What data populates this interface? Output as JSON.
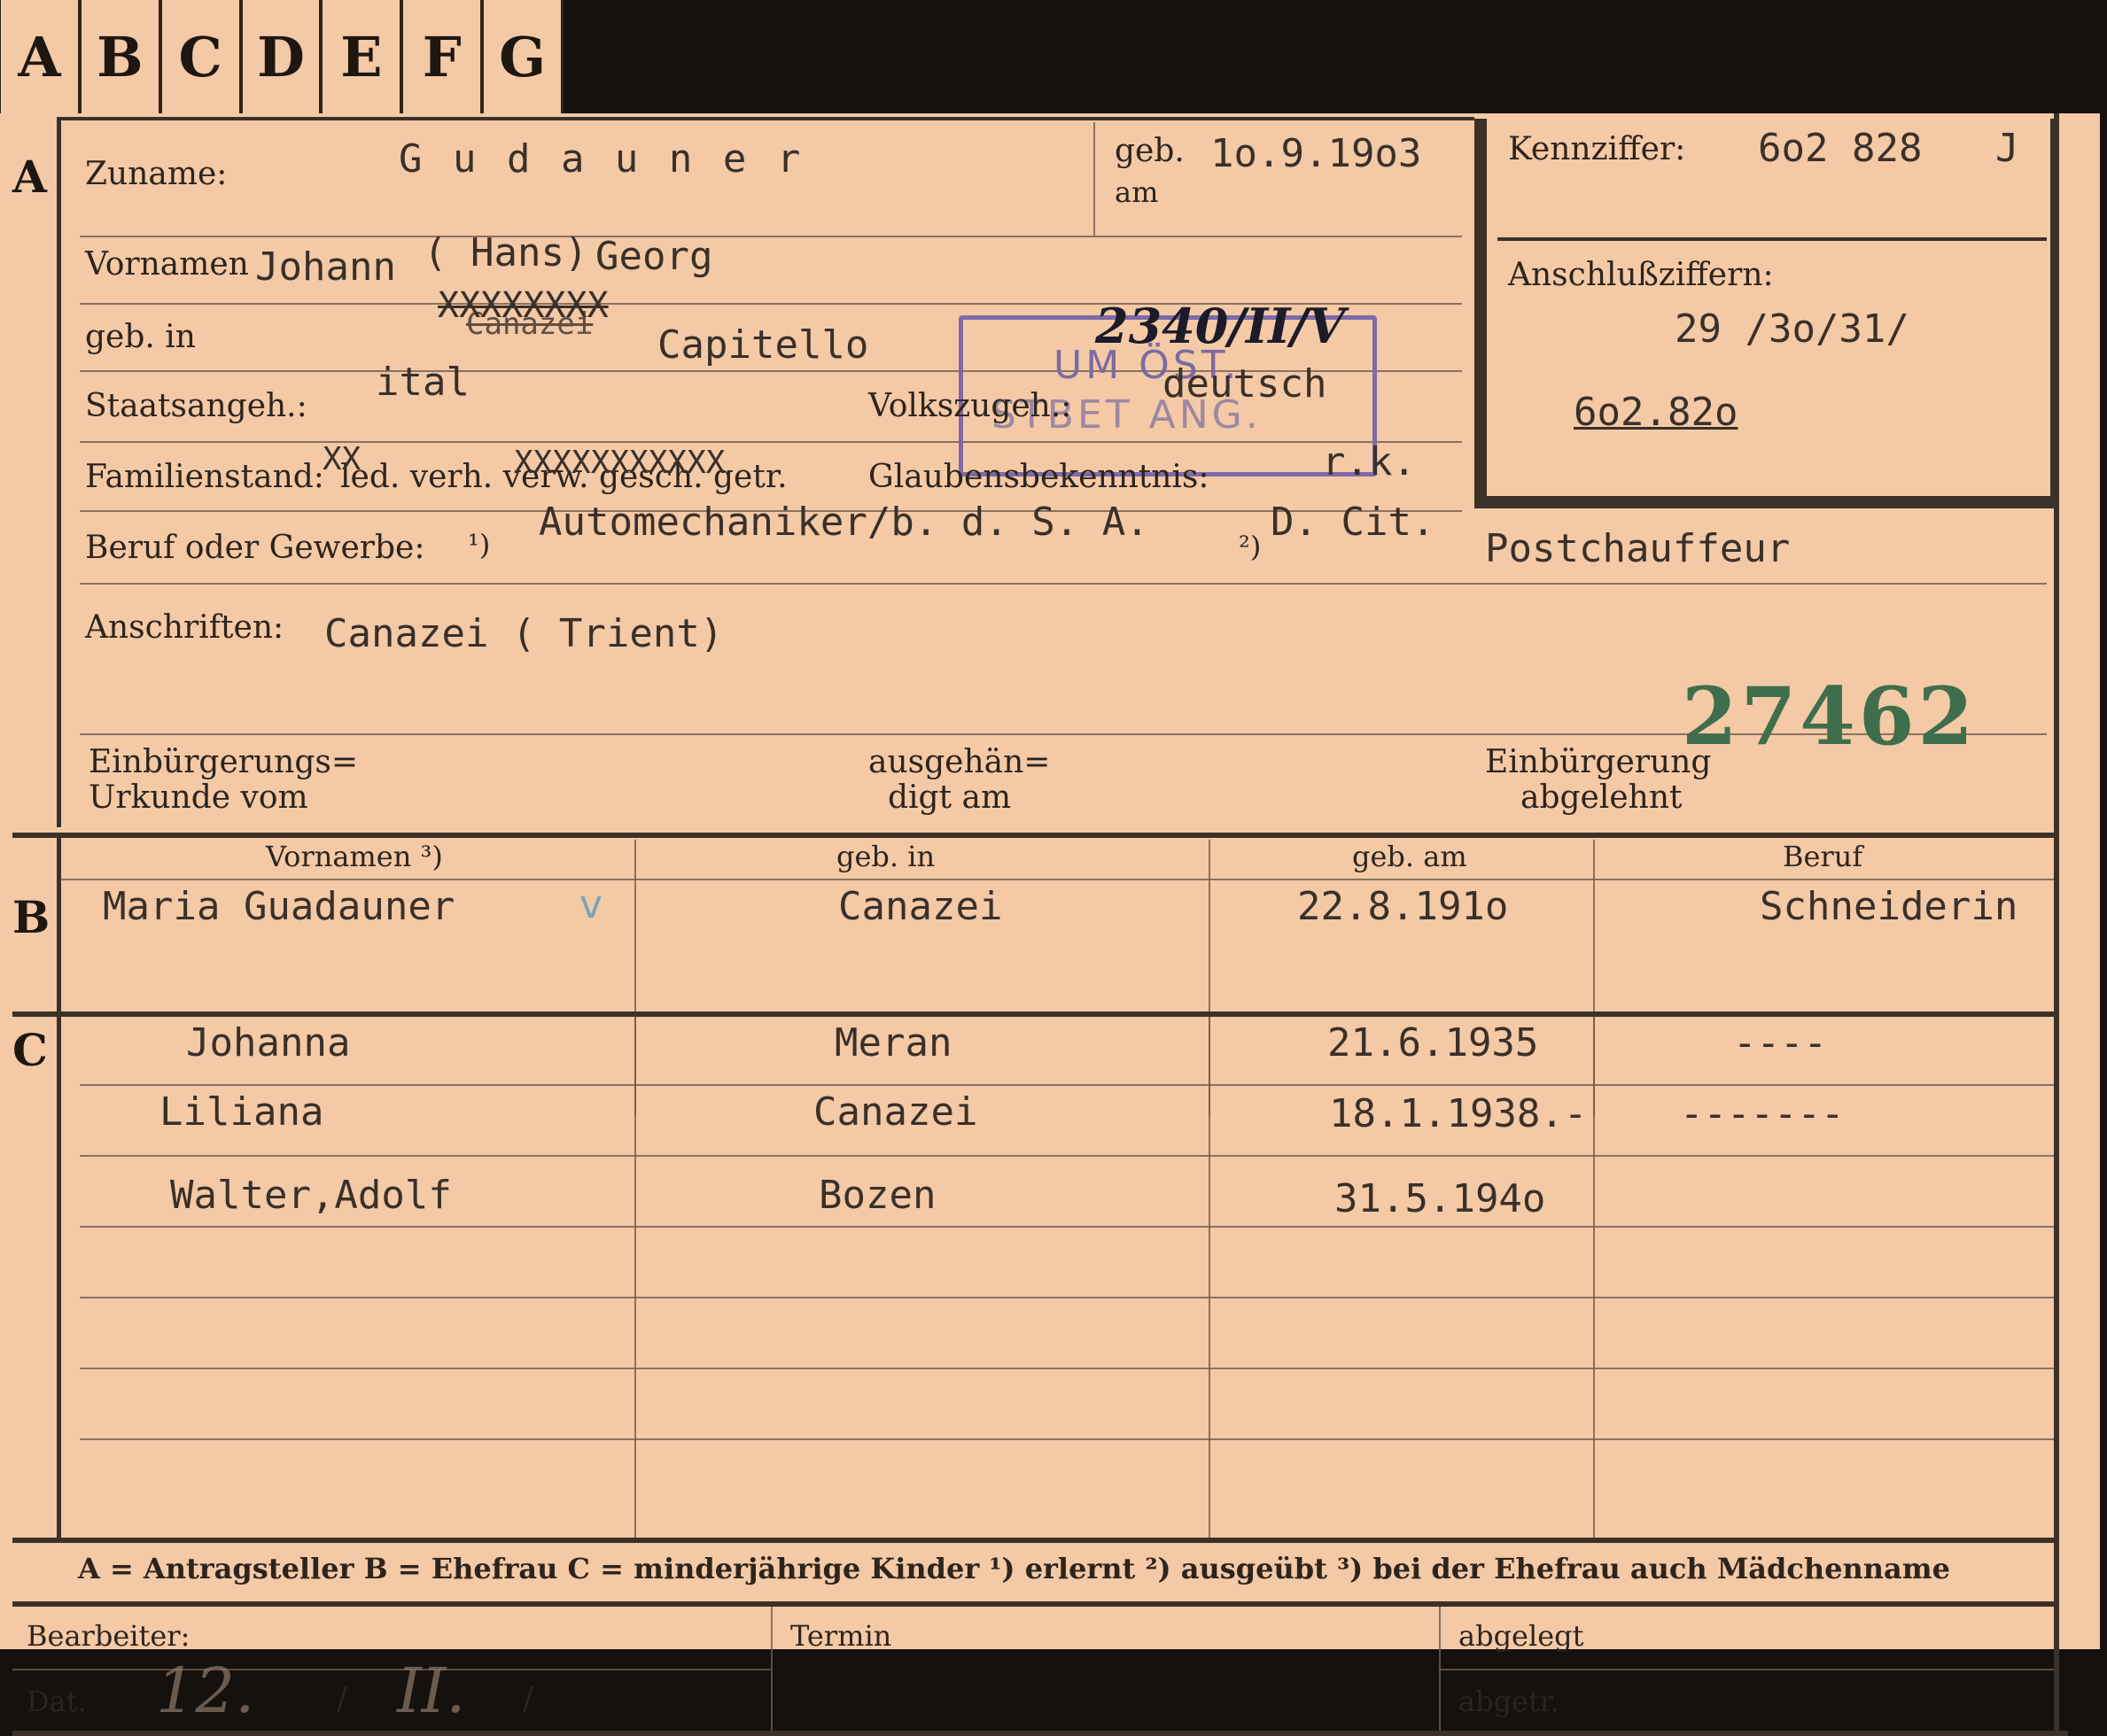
{
  "tabs": [
    "A",
    "B",
    "C",
    "D",
    "E",
    "F",
    "G"
  ],
  "sections": {
    "a": "A",
    "b": "B",
    "c": "C"
  },
  "labels": {
    "zuname": "Zuname:",
    "geb_am": "geb.",
    "am": "am",
    "vornamen": "Vornamen",
    "geb_in": "geb. in",
    "staatsangeh": "Staatsangeh.:",
    "volkszugeh": "Volkszugeh.:",
    "familienstand": "Familienstand:",
    "familienstand_opts": "led. verh. verw. gesch. getr.",
    "glauben": "Glaubensbekenntnis:",
    "beruf": "Beruf oder Gewerbe:",
    "beruf_sup": "¹)",
    "beruf_sup2": "²)",
    "anschriften": "Anschriften:",
    "einb_urkunde_1": "Einbürgerungs=",
    "einb_urkunde_2": "Urkunde vom",
    "ausgehaendigt_1": "ausgehän=",
    "ausgehaendigt_2": "digt am",
    "einb_abgelehnt_1": "Einbürgerung",
    "einb_abgelehnt_2": "abgelehnt",
    "kennziffer": "Kennziffer:",
    "anschlussziffern": "Anschlußziffern:"
  },
  "values": {
    "zuname": "G u d a u n e r",
    "geb_datum": "1o.9.19o3",
    "vornamen": "Johann",
    "vornamen_hans": "( Hans)",
    "vornamen_georg": "Georg",
    "crossed_x": "XXXXXXXX",
    "geb_in_struck": "Canazei",
    "geb_in": "Capitello",
    "staatsangeh": "ital",
    "volkszugeh": "deutsch",
    "fam_x1": "XX",
    "fam_x2": "XXXXXXXXXXX",
    "glauben": "r.k.",
    "beruf": "Automechaniker/b. d. S. A.",
    "beruf_2": "D. Cit.",
    "beruf_ausgeuebt": "Postchauffeur",
    "anschrift": "Canazei ( Trient)",
    "kennziffer": "6o2 828",
    "kennziffer_suffix": "J",
    "anschluss_1": "29 /3o/31/",
    "anschluss_2": "6o2.82o",
    "green_number": "27462"
  },
  "stamp": {
    "line1": "UM ÖST.",
    "line2": "STBET ANG.",
    "handwritten": "2340/II/V"
  },
  "spouse_headers": [
    "Vornamen ³)",
    "geb. in",
    "geb. am",
    "Beruf"
  ],
  "spouse": {
    "name": "Maria Guadauner",
    "birthplace": "Canazei",
    "birthdate": "22.8.191o",
    "occupation": "Schneiderin",
    "tick": "v"
  },
  "children": [
    {
      "name": "Johanna",
      "birthplace": "Meran",
      "birthdate": "21.6.1935",
      "occupation": "----"
    },
    {
      "name": "Liliana",
      "birthplace": "Canazei",
      "birthdate": "18.1.1938.-",
      "occupation": "-------"
    },
    {
      "name": "Walter,Adolf",
      "birthplace": "Bozen",
      "birthdate": "31.5.194o",
      "occupation": ""
    }
  ],
  "legend": "A = Antragsteller   B = Ehefrau   C = minderjährige Kinder   ¹) erlernt   ²) ausgeübt   ³) bei der Ehefrau auch Mädchenname",
  "footer": {
    "bearbeiter": "Bearbeiter:",
    "dat": "Dat.",
    "dat_slash1": "/",
    "dat_slash2": "/",
    "dat_hand1": "12.",
    "dat_hand2": "II.",
    "termin": "Termin",
    "abgelegt": "abgelegt",
    "abgetr": "abgetr."
  },
  "colors": {
    "card": "#f4c9a6",
    "background": "#15110d",
    "stamp": "#7a6ca3",
    "green": "#3f6e4c"
  }
}
